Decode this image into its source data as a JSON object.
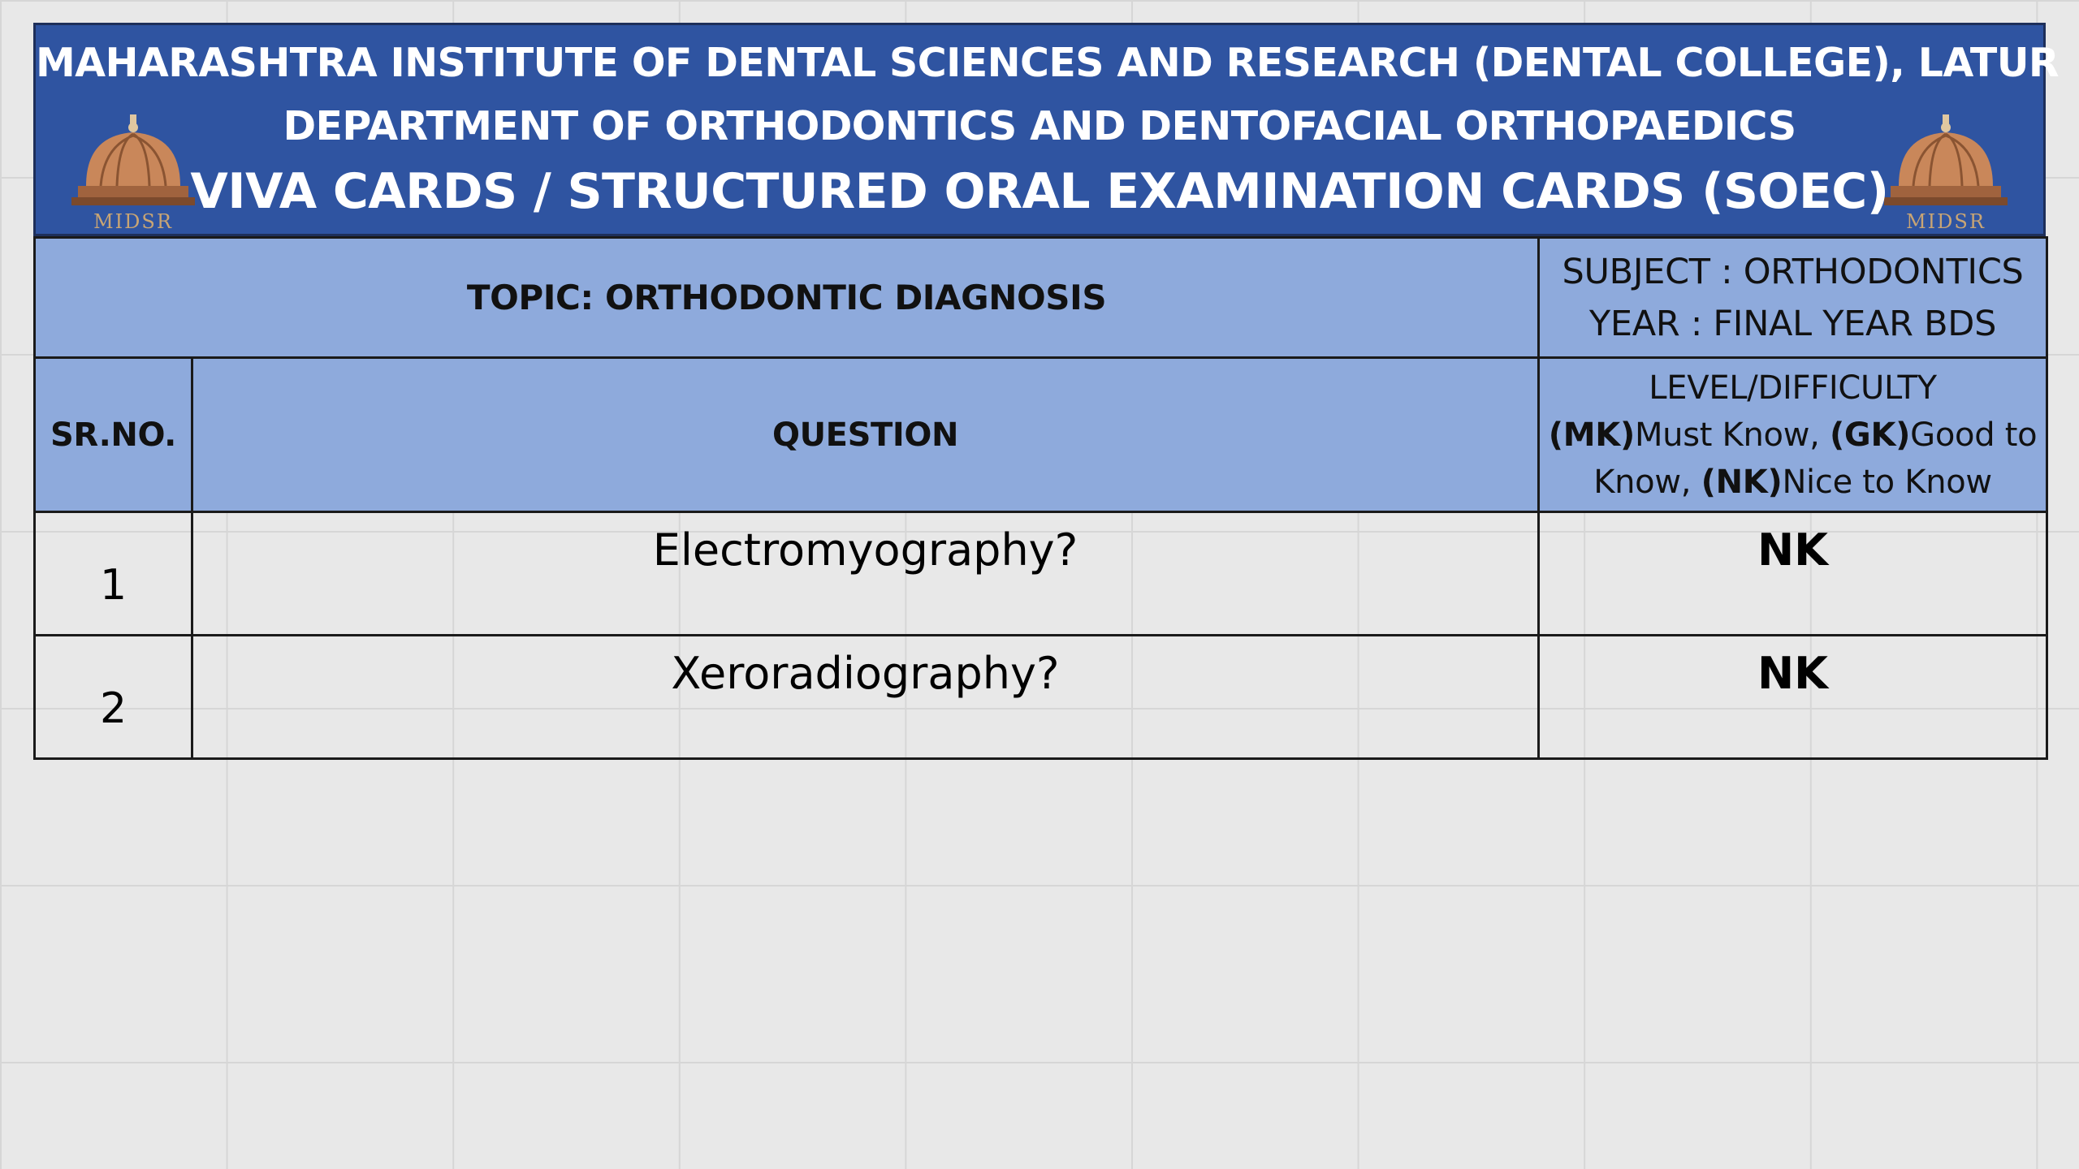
{
  "header": {
    "institute": "MAHARASHTRA INSTITUTE OF DENTAL SCIENCES AND RESEARCH (DENTAL COLLEGE), LATUR",
    "department": "DEPARTMENT OF ORTHODONTICS AND DENTOFACIAL ORTHOPAEDICS",
    "card_title": "VIVA CARDS / STRUCTURED ORAL EXAMINATION CARDS (SOEC)",
    "logo_text": "MIDSR"
  },
  "topic": "TOPIC: ORTHODONTIC DIAGNOSIS",
  "subject": "SUBJECT : ORTHODONTICS",
  "year": "YEAR : FINAL YEAR BDS",
  "columns": {
    "sr_no": "SR.NO.",
    "question": "QUESTION",
    "level_title": "LEVEL/DIFFICULTY",
    "mk_code": "(MK)",
    "mk_label": "Must Know, ",
    "gk_code": "(GK)",
    "gk_label": "Good to Know, ",
    "nk_code": "(NK)",
    "nk_label": "Nice to Know"
  },
  "rows": [
    {
      "sr": "1",
      "question": "Electromyography?",
      "level": "NK"
    },
    {
      "sr": "2",
      "question": "Xeroradiography?",
      "level": "NK"
    }
  ],
  "colors": {
    "banner": "#2f54a1",
    "header_cells": "#8eaadc",
    "logo_dome": "#c9875a"
  }
}
